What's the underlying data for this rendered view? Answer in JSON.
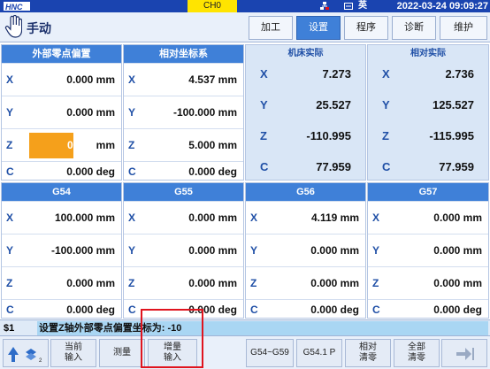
{
  "topbar": {
    "channel": "CH0",
    "language": "英",
    "datetime": "2022-03-24 09:09:27",
    "icons": [
      "hnc-logo",
      "network-icon",
      "keyboard-icon"
    ]
  },
  "title": {
    "mode": "手动",
    "tabs": [
      {
        "label": "加工",
        "active": false
      },
      {
        "label": "设置",
        "active": true
      },
      {
        "label": "程序",
        "active": false
      },
      {
        "label": "诊断",
        "active": false
      },
      {
        "label": "维护",
        "active": false
      }
    ]
  },
  "ext_offset": {
    "header": "外部零点偏置",
    "rows": [
      {
        "axis": "X",
        "value": "0.000 mm"
      },
      {
        "axis": "Y",
        "value": "0.000 mm"
      },
      {
        "axis": "Z",
        "value": "0.000",
        "unit": "mm",
        "editing": true
      },
      {
        "axis": "C",
        "value": "0.000 deg"
      }
    ]
  },
  "relative": {
    "header": "相对坐标系",
    "rows": [
      {
        "axis": "X",
        "value": "4.537 mm"
      },
      {
        "axis": "Y",
        "value": "-100.000 mm"
      },
      {
        "axis": "Z",
        "value": "5.000 mm"
      },
      {
        "axis": "C",
        "value": "0.000 deg"
      }
    ]
  },
  "machine_actual": {
    "header": "机床实际",
    "rows": [
      {
        "axis": "X",
        "value": "7.273"
      },
      {
        "axis": "Y",
        "value": "25.527"
      },
      {
        "axis": "Z",
        "value": "-110.995"
      },
      {
        "axis": "C",
        "value": "77.959"
      }
    ]
  },
  "relative_actual": {
    "header": "相对实际",
    "rows": [
      {
        "axis": "X",
        "value": "2.736"
      },
      {
        "axis": "Y",
        "value": "125.527"
      },
      {
        "axis": "Z",
        "value": "-115.995"
      },
      {
        "axis": "C",
        "value": "77.959"
      }
    ]
  },
  "g54": {
    "header": "G54",
    "rows": [
      {
        "axis": "X",
        "value": "100.000 mm"
      },
      {
        "axis": "Y",
        "value": "-100.000 mm"
      },
      {
        "axis": "Z",
        "value": "0.000 mm"
      },
      {
        "axis": "C",
        "value": "0.000 deg"
      }
    ]
  },
  "g55": {
    "header": "G55",
    "rows": [
      {
        "axis": "X",
        "value": "0.000 mm"
      },
      {
        "axis": "Y",
        "value": "0.000 mm"
      },
      {
        "axis": "Z",
        "value": "0.000 mm"
      },
      {
        "axis": "C",
        "value": "0.000 deg"
      }
    ]
  },
  "g56": {
    "header": "G56",
    "rows": [
      {
        "axis": "X",
        "value": "4.119 mm"
      },
      {
        "axis": "Y",
        "value": "0.000 mm"
      },
      {
        "axis": "Z",
        "value": "0.000 mm"
      },
      {
        "axis": "C",
        "value": "0.000 deg"
      }
    ]
  },
  "g57": {
    "header": "G57",
    "rows": [
      {
        "axis": "X",
        "value": "0.000 mm"
      },
      {
        "axis": "Y",
        "value": "0.000 mm"
      },
      {
        "axis": "Z",
        "value": "0.000 mm"
      },
      {
        "axis": "C",
        "value": "0.000 deg"
      }
    ]
  },
  "status": {
    "step": "$1",
    "message": "设置Z轴外部零点偏置坐标为: -10"
  },
  "softkeys": [
    {
      "id": "current-input",
      "label": "当前\n输入"
    },
    {
      "id": "measure",
      "label": "测量"
    },
    {
      "id": "increment-input",
      "label": "增量\n输入"
    },
    {
      "id": "g54-g59",
      "label": "G54~G59"
    },
    {
      "id": "g541p",
      "label": "G54.1 P"
    },
    {
      "id": "relative-clear",
      "label": "相对\n清零"
    },
    {
      "id": "all-clear",
      "label": "全部\n清零"
    }
  ],
  "page_indicator": "2",
  "colors": {
    "header_blue": "#3f80d8",
    "topbar_blue": "#1a44b0",
    "edit_orange": "#f5a01b",
    "highlight_red": "#e0141e",
    "channel_yellow": "#ffe400"
  }
}
